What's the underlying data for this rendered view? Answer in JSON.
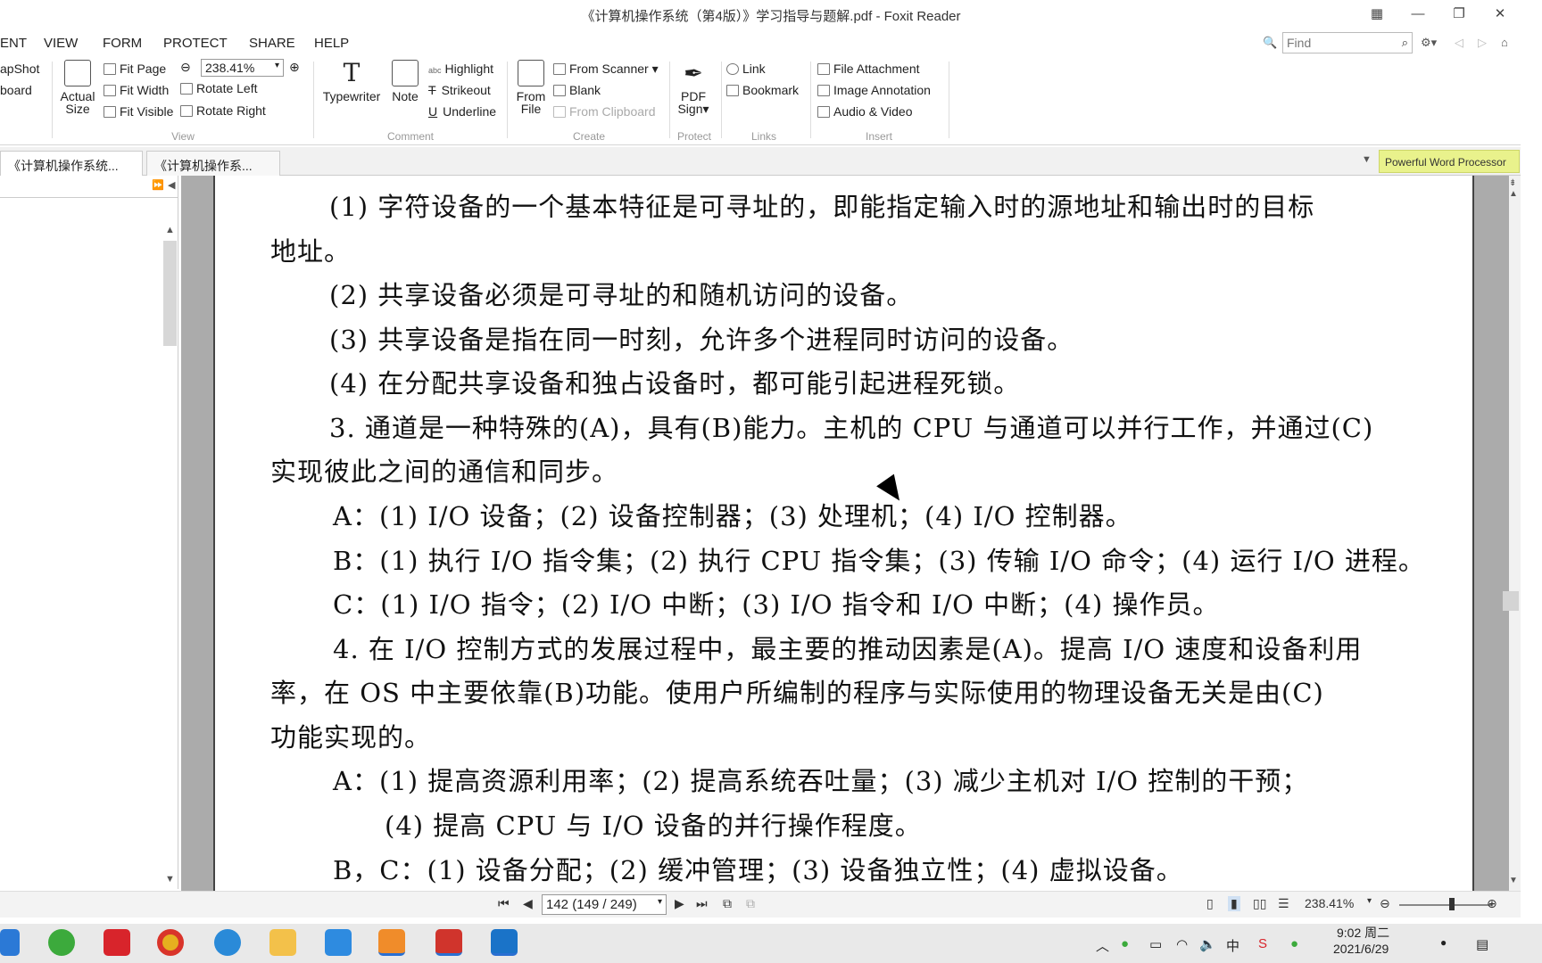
{
  "window": {
    "title": "《计算机操作系统（第4版）》学习指导与题解.pdf - Foxit Reader"
  },
  "menu": [
    "ENT",
    "VIEW",
    "FORM",
    "PROTECT",
    "SHARE",
    "HELP"
  ],
  "search": {
    "placeholder": "Find"
  },
  "ribbon": {
    "snapshot": "apShot",
    "clipboard": "board",
    "actual_size_l1": "Actual",
    "actual_size_l2": "Size",
    "fit_page": "Fit Page",
    "fit_width": "Fit Width",
    "fit_visible": "Fit Visible",
    "zoom": "238.41%",
    "rotate_left": "Rotate Left",
    "rotate_right": "Rotate Right",
    "group_view": "View",
    "typewriter": "Typewriter",
    "note": "Note",
    "highlight": "Highlight",
    "strikeout": "Strikeout",
    "underline": "Underline",
    "group_comment": "Comment",
    "from_file_l1": "From",
    "from_file_l2": "File",
    "from_scanner": "From Scanner",
    "blank": "Blank",
    "from_clipboard": "From Clipboard",
    "group_create": "Create",
    "pdf_sign_l1": "PDF",
    "pdf_sign_l2": "Sign",
    "group_protect": "Protect",
    "link": "Link",
    "bookmark": "Bookmark",
    "group_links": "Links",
    "file_attachment": "File Attachment",
    "image_annotation": "Image Annotation",
    "audio_video": "Audio & Video",
    "group_insert": "Insert"
  },
  "tabs": [
    "《计算机操作系统...",
    "《计算机操作系..."
  ],
  "ad": "Powerful Word Processor",
  "document": {
    "lines": [
      "(1) 字符设备的一个基本特征是可寻址的，即能指定输入时的源地址和输出时的目标",
      "地址。",
      "(2) 共享设备必须是可寻址的和随机访问的设备。",
      "(3) 共享设备是指在同一时刻，允许多个进程同时访问的设备。",
      "(4) 在分配共享设备和独占设备时，都可能引起进程死锁。",
      "3. 通道是一种特殊的(A)，具有(B)能力。主机的 CPU 与通道可以并行工作，并通过(C)",
      "实现彼此之间的通信和同步。",
      "A：(1) I/O 设备；(2) 设备控制器；(3) 处理机；(4) I/O 控制器。",
      "B：(1) 执行 I/O 指令集；(2) 执行 CPU 指令集；(3) 传输 I/O 命令；(4) 运行 I/O 进程。",
      "C：(1) I/O 指令；(2) I/O 中断；(3) I/O 指令和 I/O 中断；(4) 操作员。",
      "4. 在 I/O 控制方式的发展过程中，最主要的推动因素是(A)。提高 I/O 速度和设备利用",
      "率，在 OS 中主要依靠(B)功能。使用户所编制的程序与实际使用的物理设备无关是由(C)",
      "功能实现的。",
      "A：(1) 提高资源利用率；(2) 提高系统吞吐量；(3) 减少主机对 I/O 控制的干预；",
      "(4) 提高 CPU 与 I/O 设备的并行操作程度。",
      "B，C：(1) 设备分配；(2) 缓冲管理；(3) 设备独立性；(4) 虚拟设备。"
    ]
  },
  "status": {
    "page": "142 (149 / 249)",
    "zoom": "238.41%"
  },
  "taskbar": {
    "time": "9:02 周二",
    "date": "2021/6/29",
    "ime": "中"
  }
}
